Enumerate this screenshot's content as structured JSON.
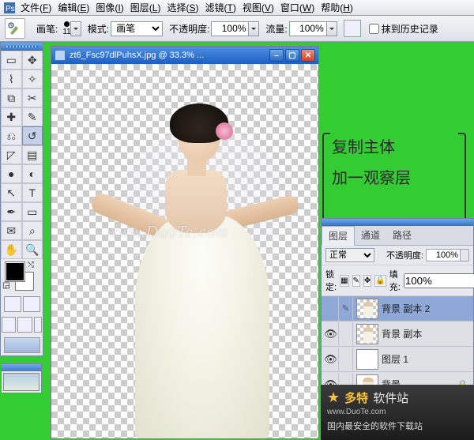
{
  "menu": {
    "items": [
      {
        "label": "文件",
        "hot": "F"
      },
      {
        "label": "编辑",
        "hot": "E"
      },
      {
        "label": "图像",
        "hot": "I"
      },
      {
        "label": "图层",
        "hot": "L"
      },
      {
        "label": "选择",
        "hot": "S"
      },
      {
        "label": "滤镜",
        "hot": "T"
      },
      {
        "label": "视图",
        "hot": "V"
      },
      {
        "label": "窗口",
        "hot": "W"
      },
      {
        "label": "帮助",
        "hot": "H"
      }
    ]
  },
  "options": {
    "brush_label": "画笔:",
    "brush_size": "11",
    "mode_label": "模式:",
    "mode_value": "画笔",
    "opacity_label": "不透明度:",
    "opacity_value": "100%",
    "flow_label": "流量:",
    "flow_value": "100%",
    "history_label": "抹到历史记录"
  },
  "window": {
    "title": "zt6_Fsc97dlPuhsX.jpg @ 33.3% ..."
  },
  "watermark": "www.DuoTe.com",
  "annotation": {
    "line1": "复制主体",
    "line2": "加一观察层"
  },
  "panel": {
    "tabs": [
      "图层",
      "通道",
      "路径"
    ],
    "blend_value": "正常",
    "opacity_label": "不透明度:",
    "opacity_value": "100%",
    "lock_label": "锁定:",
    "fill_label": "填充:",
    "fill_value": "100%",
    "layers": [
      {
        "name": "背景 副本 2",
        "visible": false,
        "selected": true,
        "thumb": "trans"
      },
      {
        "name": "背景 副本",
        "visible": true,
        "selected": false,
        "thumb": "trans"
      },
      {
        "name": "图层 1",
        "visible": true,
        "selected": false,
        "thumb": "white-blank"
      },
      {
        "name": "背景",
        "visible": true,
        "selected": false,
        "thumb": "white",
        "locked": true
      }
    ]
  },
  "footer": {
    "brand": "多特",
    "suffix": "软件站",
    "domain": "www.DuoTe.com",
    "tagline": "国内最安全的软件下载站"
  }
}
